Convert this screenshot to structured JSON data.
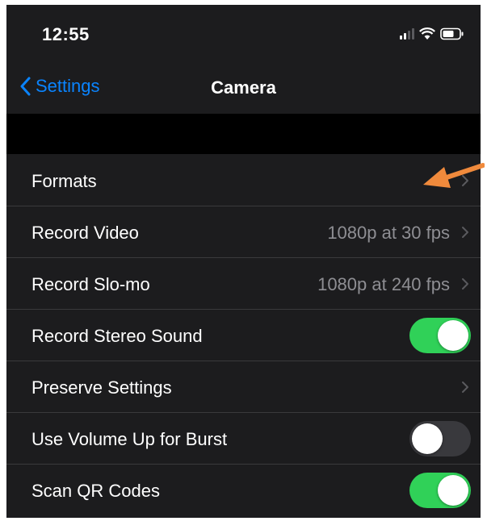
{
  "status_bar": {
    "time": "12:55"
  },
  "nav": {
    "back_label": "Settings",
    "title": "Camera"
  },
  "rows": [
    {
      "label": "Formats",
      "value": "",
      "control": "chevron"
    },
    {
      "label": "Record Video",
      "value": "1080p at 30 fps",
      "control": "chevron"
    },
    {
      "label": "Record Slo-mo",
      "value": "1080p at 240 fps",
      "control": "chevron"
    },
    {
      "label": "Record Stereo Sound",
      "value": "",
      "control": "toggle",
      "toggle_state": "on"
    },
    {
      "label": "Preserve Settings",
      "value": "",
      "control": "chevron"
    },
    {
      "label": "Use Volume Up for Burst",
      "value": "",
      "control": "toggle",
      "toggle_state": "off"
    },
    {
      "label": "Scan QR Codes",
      "value": "",
      "control": "toggle",
      "toggle_state": "on"
    }
  ],
  "colors": {
    "accent": "#0a84ff",
    "toggle_on": "#30d158",
    "annotation_arrow": "#f08a3c"
  },
  "icons": {
    "back": "chevron-left-icon",
    "disclosure": "chevron-right-icon",
    "annotation": "orange-arrow-annotation"
  }
}
